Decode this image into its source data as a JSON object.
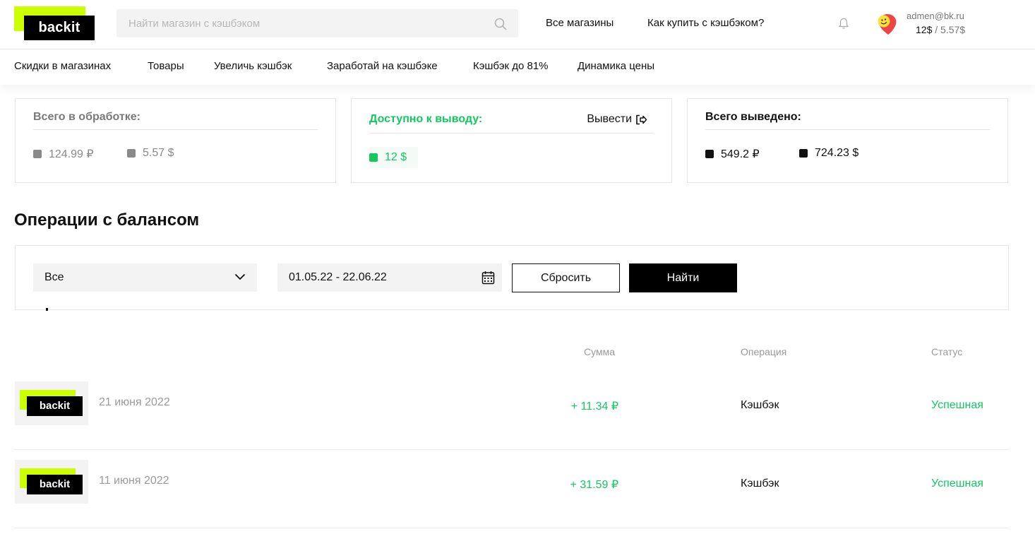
{
  "header": {
    "logo_text": "backit",
    "search_placeholder": "Найти магазин с кэшбэком",
    "nav": [
      "Все магазины",
      "Как купить с кэшбэком?"
    ],
    "user_email": "admen@bk.ru",
    "balance_main": "12$",
    "balance_sub": " / 5.57$"
  },
  "subnav": [
    "Скидки в магазинах",
    "Товары",
    "Увеличь кэшбэк",
    "Заработай на кэшбэке",
    "Кэшбэк до 81%",
    "Динамика цены"
  ],
  "cards": {
    "processing": {
      "title": "Всего в обработке:",
      "values": [
        "124.99 ₽",
        "5.57 $"
      ]
    },
    "available": {
      "title": "Доступно к выводу:",
      "action": "Вывести",
      "values": [
        "12 $"
      ]
    },
    "withdrawn": {
      "title": "Всего выведено:",
      "values": [
        "549.2 ₽",
        "724.23 $"
      ]
    }
  },
  "section_title": "Операции с балансом",
  "filter": {
    "type_value": "Все",
    "date_range": "01.05.22 - 22.06.22",
    "reset_label": "Сбросить",
    "find_label": "Найти"
  },
  "table": {
    "headers": [
      "Сумма",
      "Операция",
      "Статус"
    ],
    "rows": [
      {
        "date": "21 июня 2022",
        "amount": "+ 11.34 ₽",
        "operation": "Кэшбэк",
        "status": "Успешная"
      },
      {
        "date": "11 июня 2022",
        "amount": "+ 31.59 ₽",
        "operation": "Кэшбэк",
        "status": "Успешная"
      }
    ]
  },
  "colors": {
    "accent_green": "#12c960",
    "brand_lime": "#ccff00",
    "black": "#000000"
  }
}
